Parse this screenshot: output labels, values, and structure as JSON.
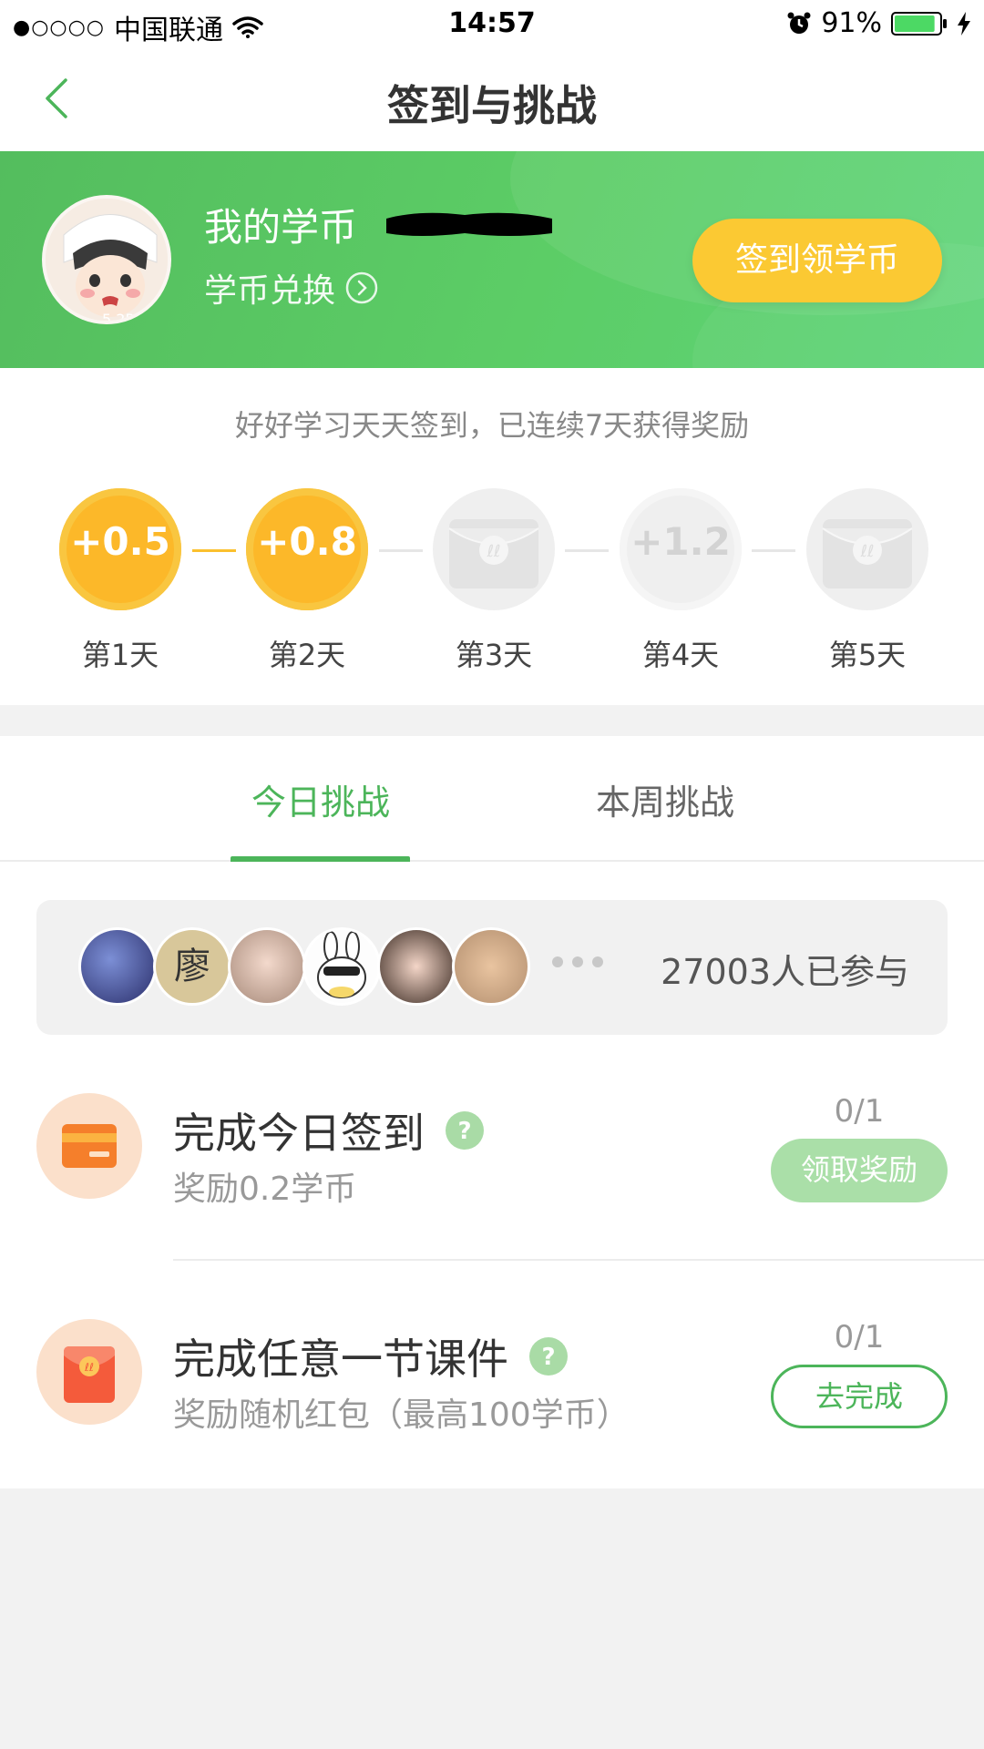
{
  "status_bar": {
    "signal": "●○○○○",
    "carrier": "中国联通",
    "time": "14:57",
    "battery": "91%",
    "battery_level": 0.91
  },
  "nav": {
    "title": "签到与挑战"
  },
  "hero": {
    "coin_title": "我的学币",
    "exchange_label": "学币兑换",
    "signin_button": "签到领学币",
    "avatar_text": "5.2P"
  },
  "checkin": {
    "note": "好好学习天天签到，已连续7天获得奖励",
    "days": [
      {
        "label": "第1天",
        "value": "+0.5",
        "state": "claimed"
      },
      {
        "label": "第2天",
        "value": "+0.8",
        "state": "claimed"
      },
      {
        "label": "第3天",
        "value": "",
        "state": "envelope"
      },
      {
        "label": "第4天",
        "value": "+1.2",
        "state": "locked"
      },
      {
        "label": "第5天",
        "value": "",
        "state": "envelope"
      }
    ]
  },
  "tabs": [
    {
      "label": "今日挑战",
      "active": true
    },
    {
      "label": "本周挑战",
      "active": false
    }
  ],
  "participants": {
    "count_text": "27003人已参与",
    "avatar_glyph": "廖"
  },
  "tasks": [
    {
      "title": "完成今日签到",
      "subtitle": "奖励0.2学币",
      "progress": "0/1",
      "button": "领取奖励",
      "button_style": "claim"
    },
    {
      "title": "完成任意一节课件",
      "subtitle": "奖励随机红包（最高100学币）",
      "progress": "0/1",
      "button": "去完成",
      "button_style": "go"
    }
  ],
  "colors": {
    "accent_green": "#4cb55a",
    "hero_green": "#5ccd66",
    "gold": "#fcb829",
    "button_yellow": "#fbc933"
  }
}
